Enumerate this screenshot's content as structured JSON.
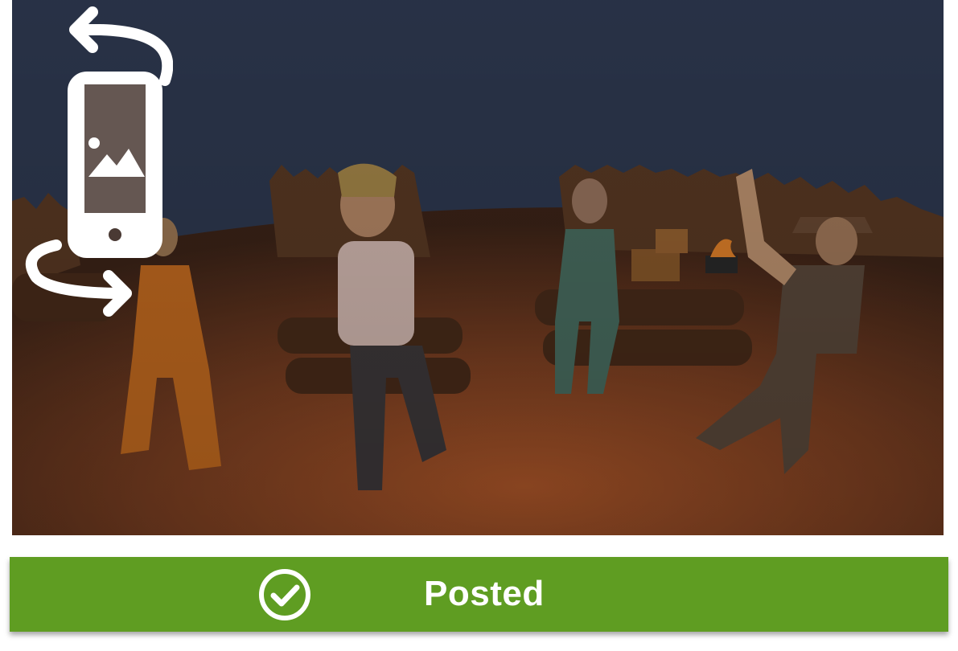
{
  "scene": {
    "description_icon": "rotate-device-icon",
    "sky_color": "#2f3a52",
    "ground_color": "#8a4a24",
    "characters": [
      "astronaut",
      "girl-tank-top",
      "woman-tracksuit",
      "cowboy"
    ]
  },
  "status": {
    "label": "Posted",
    "icon": "check-circle-icon",
    "color": "#5f9d22"
  }
}
